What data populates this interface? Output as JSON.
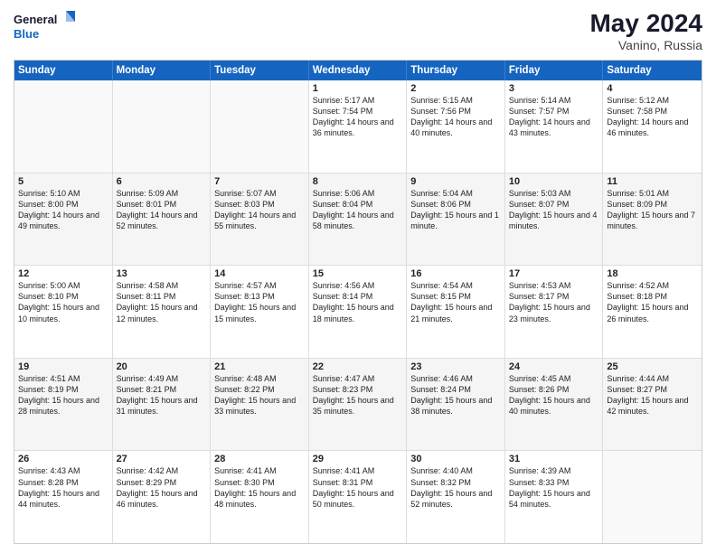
{
  "header": {
    "logo_general": "General",
    "logo_blue": "Blue",
    "month_year": "May 2024",
    "location": "Vanino, Russia"
  },
  "days_of_week": [
    "Sunday",
    "Monday",
    "Tuesday",
    "Wednesday",
    "Thursday",
    "Friday",
    "Saturday"
  ],
  "rows": [
    [
      {
        "day": "",
        "empty": true
      },
      {
        "day": "",
        "empty": true
      },
      {
        "day": "",
        "empty": true
      },
      {
        "day": "1",
        "sunrise": "5:17 AM",
        "sunset": "7:54 PM",
        "daylight": "14 hours and 36 minutes."
      },
      {
        "day": "2",
        "sunrise": "5:15 AM",
        "sunset": "7:56 PM",
        "daylight": "14 hours and 40 minutes."
      },
      {
        "day": "3",
        "sunrise": "5:14 AM",
        "sunset": "7:57 PM",
        "daylight": "14 hours and 43 minutes."
      },
      {
        "day": "4",
        "sunrise": "5:12 AM",
        "sunset": "7:58 PM",
        "daylight": "14 hours and 46 minutes."
      }
    ],
    [
      {
        "day": "5",
        "sunrise": "5:10 AM",
        "sunset": "8:00 PM",
        "daylight": "14 hours and 49 minutes."
      },
      {
        "day": "6",
        "sunrise": "5:09 AM",
        "sunset": "8:01 PM",
        "daylight": "14 hours and 52 minutes."
      },
      {
        "day": "7",
        "sunrise": "5:07 AM",
        "sunset": "8:03 PM",
        "daylight": "14 hours and 55 minutes."
      },
      {
        "day": "8",
        "sunrise": "5:06 AM",
        "sunset": "8:04 PM",
        "daylight": "14 hours and 58 minutes."
      },
      {
        "day": "9",
        "sunrise": "5:04 AM",
        "sunset": "8:06 PM",
        "daylight": "15 hours and 1 minute."
      },
      {
        "day": "10",
        "sunrise": "5:03 AM",
        "sunset": "8:07 PM",
        "daylight": "15 hours and 4 minutes."
      },
      {
        "day": "11",
        "sunrise": "5:01 AM",
        "sunset": "8:09 PM",
        "daylight": "15 hours and 7 minutes."
      }
    ],
    [
      {
        "day": "12",
        "sunrise": "5:00 AM",
        "sunset": "8:10 PM",
        "daylight": "15 hours and 10 minutes."
      },
      {
        "day": "13",
        "sunrise": "4:58 AM",
        "sunset": "8:11 PM",
        "daylight": "15 hours and 12 minutes."
      },
      {
        "day": "14",
        "sunrise": "4:57 AM",
        "sunset": "8:13 PM",
        "daylight": "15 hours and 15 minutes."
      },
      {
        "day": "15",
        "sunrise": "4:56 AM",
        "sunset": "8:14 PM",
        "daylight": "15 hours and 18 minutes."
      },
      {
        "day": "16",
        "sunrise": "4:54 AM",
        "sunset": "8:15 PM",
        "daylight": "15 hours and 21 minutes."
      },
      {
        "day": "17",
        "sunrise": "4:53 AM",
        "sunset": "8:17 PM",
        "daylight": "15 hours and 23 minutes."
      },
      {
        "day": "18",
        "sunrise": "4:52 AM",
        "sunset": "8:18 PM",
        "daylight": "15 hours and 26 minutes."
      }
    ],
    [
      {
        "day": "19",
        "sunrise": "4:51 AM",
        "sunset": "8:19 PM",
        "daylight": "15 hours and 28 minutes."
      },
      {
        "day": "20",
        "sunrise": "4:49 AM",
        "sunset": "8:21 PM",
        "daylight": "15 hours and 31 minutes."
      },
      {
        "day": "21",
        "sunrise": "4:48 AM",
        "sunset": "8:22 PM",
        "daylight": "15 hours and 33 minutes."
      },
      {
        "day": "22",
        "sunrise": "4:47 AM",
        "sunset": "8:23 PM",
        "daylight": "15 hours and 35 minutes."
      },
      {
        "day": "23",
        "sunrise": "4:46 AM",
        "sunset": "8:24 PM",
        "daylight": "15 hours and 38 minutes."
      },
      {
        "day": "24",
        "sunrise": "4:45 AM",
        "sunset": "8:26 PM",
        "daylight": "15 hours and 40 minutes."
      },
      {
        "day": "25",
        "sunrise": "4:44 AM",
        "sunset": "8:27 PM",
        "daylight": "15 hours and 42 minutes."
      }
    ],
    [
      {
        "day": "26",
        "sunrise": "4:43 AM",
        "sunset": "8:28 PM",
        "daylight": "15 hours and 44 minutes."
      },
      {
        "day": "27",
        "sunrise": "4:42 AM",
        "sunset": "8:29 PM",
        "daylight": "15 hours and 46 minutes."
      },
      {
        "day": "28",
        "sunrise": "4:41 AM",
        "sunset": "8:30 PM",
        "daylight": "15 hours and 48 minutes."
      },
      {
        "day": "29",
        "sunrise": "4:41 AM",
        "sunset": "8:31 PM",
        "daylight": "15 hours and 50 minutes."
      },
      {
        "day": "30",
        "sunrise": "4:40 AM",
        "sunset": "8:32 PM",
        "daylight": "15 hours and 52 minutes."
      },
      {
        "day": "31",
        "sunrise": "4:39 AM",
        "sunset": "8:33 PM",
        "daylight": "15 hours and 54 minutes."
      },
      {
        "day": "",
        "empty": true
      }
    ]
  ],
  "labels": {
    "sunrise_prefix": "Sunrise: ",
    "sunset_prefix": "Sunset: ",
    "daylight_prefix": "Daylight: "
  }
}
